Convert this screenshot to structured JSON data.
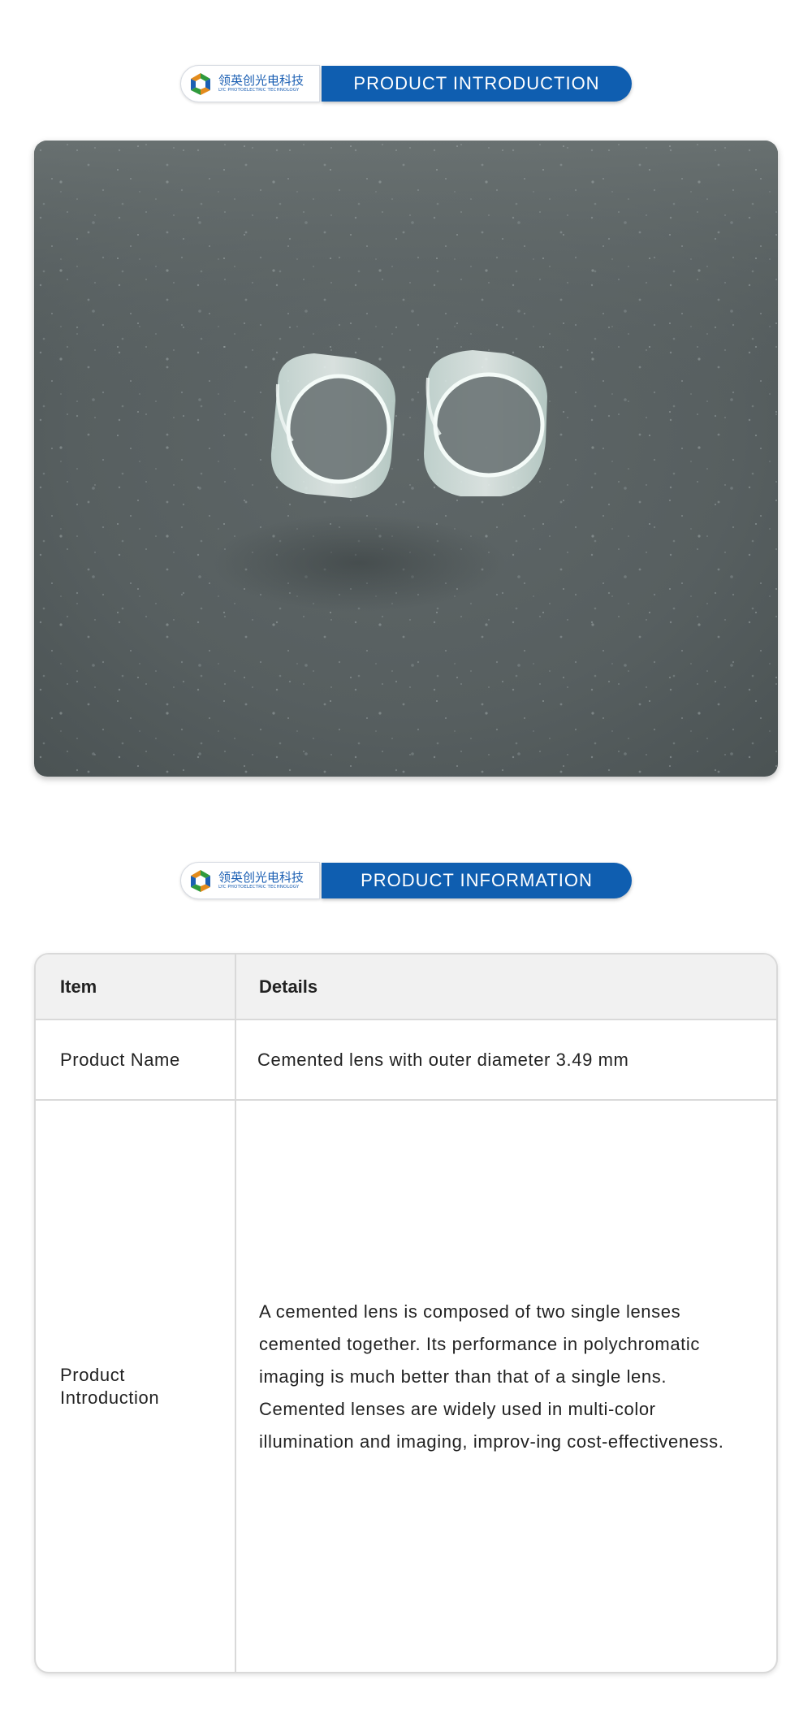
{
  "brand": {
    "name_cn": "领英创光电科技",
    "name_en": "LYC PHOTOELECTRIC TECHNOLOGY"
  },
  "sections": {
    "introduction_title": "PRODUCT INTRODUCTION",
    "information_title": "PRODUCT INFORMATION"
  },
  "table": {
    "headers": {
      "item": "Item",
      "details": "Details"
    },
    "rows": [
      {
        "label": "Product Name",
        "value": "Cemented lens with outer diameter 3.49 mm"
      },
      {
        "label": "Product\nIntroduction",
        "value": "A cemented lens is composed of two single lenses cemented together. Its performance in polychromatic imaging is much better than that of a single lens. Cemented lenses are widely used in multi-color illumination and imaging, improv-ing cost-effectiveness."
      }
    ]
  },
  "colors": {
    "brand_blue": "#0f5eb0",
    "table_border": "#d9d9d9",
    "table_header_bg": "#f1f1f1"
  },
  "icons": {
    "brand_mark": "lyc-logo-icon"
  }
}
